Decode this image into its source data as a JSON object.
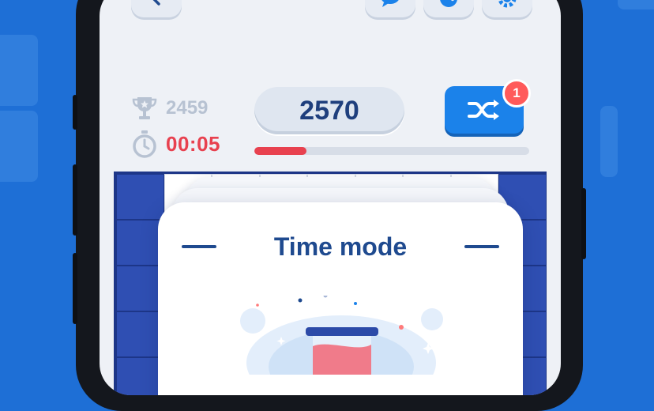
{
  "header": {
    "back_icon": "chevron-left-icon",
    "chat_icon": "chat-icon",
    "palette_icon": "palette-icon",
    "settings_icon": "gear-icon"
  },
  "stats": {
    "best_score": "2459",
    "timer": "00:05",
    "current_score": "2570",
    "timer_progress": 0.19
  },
  "shuffle": {
    "icon": "shuffle-icon",
    "badge_count": "1"
  },
  "modal": {
    "title": "Time mode",
    "illustration": "hourglass-illustration"
  },
  "colors": {
    "accent": "#1b82ea",
    "timer_red": "#e8414f",
    "board_blue": "#2f4fb3",
    "title_navy": "#1f4a8f"
  }
}
